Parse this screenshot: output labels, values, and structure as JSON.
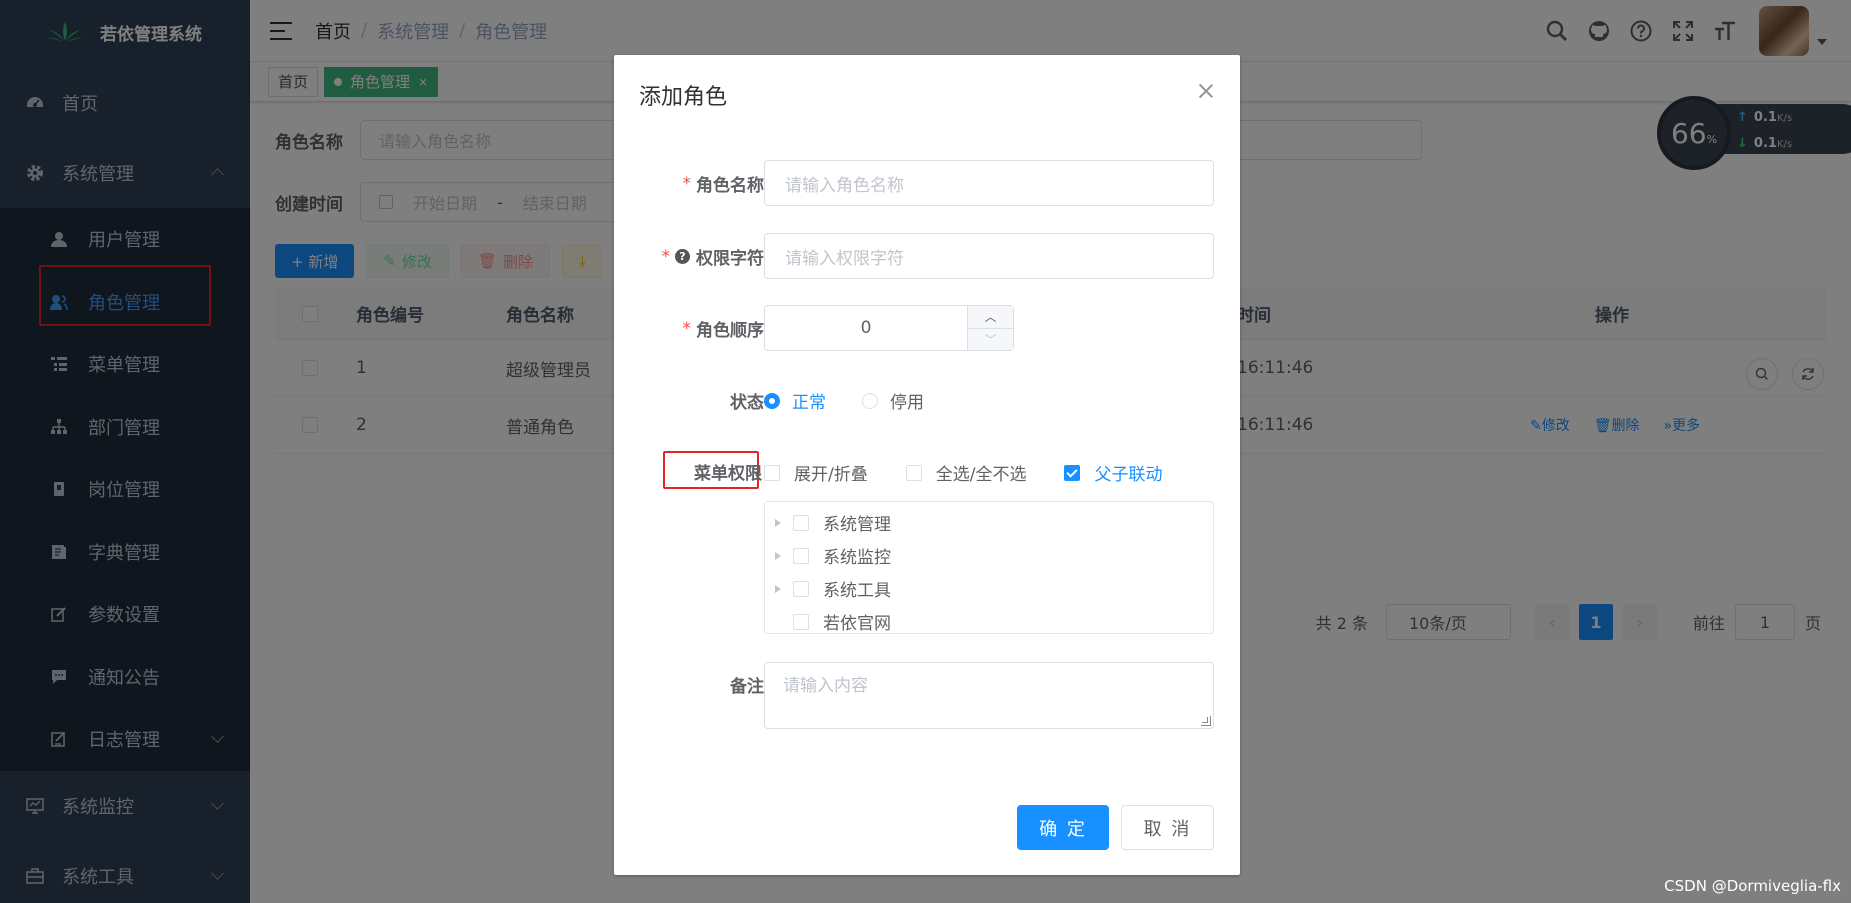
{
  "app": {
    "title": "若依管理系统"
  },
  "sidebar": {
    "home": "首页",
    "system": "系统管理",
    "items": [
      {
        "label": "用户管理",
        "icon": "user-icon"
      },
      {
        "label": "角色管理",
        "icon": "peoples-icon"
      },
      {
        "label": "菜单管理",
        "icon": "tree-table-icon"
      },
      {
        "label": "部门管理",
        "icon": "tree-icon"
      },
      {
        "label": "岗位管理",
        "icon": "post-icon"
      },
      {
        "label": "字典管理",
        "icon": "dict-icon"
      },
      {
        "label": "参数设置",
        "icon": "edit-icon"
      },
      {
        "label": "通知公告",
        "icon": "message-icon"
      },
      {
        "label": "日志管理",
        "icon": "log-icon"
      }
    ],
    "monitor": "系统监控",
    "tool": "系统工具"
  },
  "navbar": {
    "breadcrumb": [
      "首页",
      "系统管理",
      "角色管理"
    ],
    "icons": [
      "search-icon",
      "github-icon",
      "question-icon",
      "fullscreen-icon",
      "font-size-icon"
    ]
  },
  "tags": {
    "home": "首页",
    "active": "角色管理"
  },
  "search_form": {
    "role_name_label": "角色名称",
    "role_name_placeholder": "请输入角色名称",
    "time_label": "创建时间",
    "start_placeholder": "开始日期",
    "dash": "-",
    "end_placeholder": "结束日期"
  },
  "toolbar": {
    "add": "+ 新增",
    "edit": "修改",
    "delete": "删除"
  },
  "table": {
    "headers": {
      "id": "角色编号",
      "name": "角色名称",
      "time": "时间",
      "ops": "操作"
    },
    "rows": [
      {
        "id": "1",
        "name": "超级管理员",
        "time": "16:11:46"
      },
      {
        "id": "2",
        "name": "普通角色",
        "time": "16:11:46",
        "edit": "修改",
        "delete": "删除",
        "more": "更多"
      }
    ]
  },
  "pagination": {
    "total": "共 2 条",
    "size": "10条/页",
    "current": "1",
    "goto_label": "前往",
    "goto_value": "1",
    "page_unit": "页"
  },
  "speed_widget": {
    "percent": "66",
    "unit": "%",
    "up": "0.1",
    "down": "0.1",
    "rate_unit": "K/s"
  },
  "dialog": {
    "title": "添加角色",
    "role_name_label": "角色名称",
    "role_name_placeholder": "请输入角色名称",
    "role_key_label": "权限字符",
    "role_key_placeholder": "请输入权限字符",
    "role_sort_label": "角色顺序",
    "role_sort_value": "0",
    "status_label": "状态",
    "status_options": [
      "正常",
      "停用"
    ],
    "status_selected": "正常",
    "menu_label": "菜单权限",
    "menu_options": [
      {
        "label": "展开/折叠",
        "checked": false
      },
      {
        "label": "全选/全不选",
        "checked": false
      },
      {
        "label": "父子联动",
        "checked": true
      }
    ],
    "menu_tree": [
      "系统管理",
      "系统监控",
      "系统工具",
      "若依官网"
    ],
    "remark_label": "备注",
    "remark_placeholder": "请输入内容",
    "ok": "确 定",
    "cancel": "取 消"
  },
  "watermark": "CSDN @Dormiveglia-flx",
  "colors": {
    "sidebar_bg": "#304156",
    "primary": "#1890ff",
    "highlight_border": "#e62424"
  }
}
